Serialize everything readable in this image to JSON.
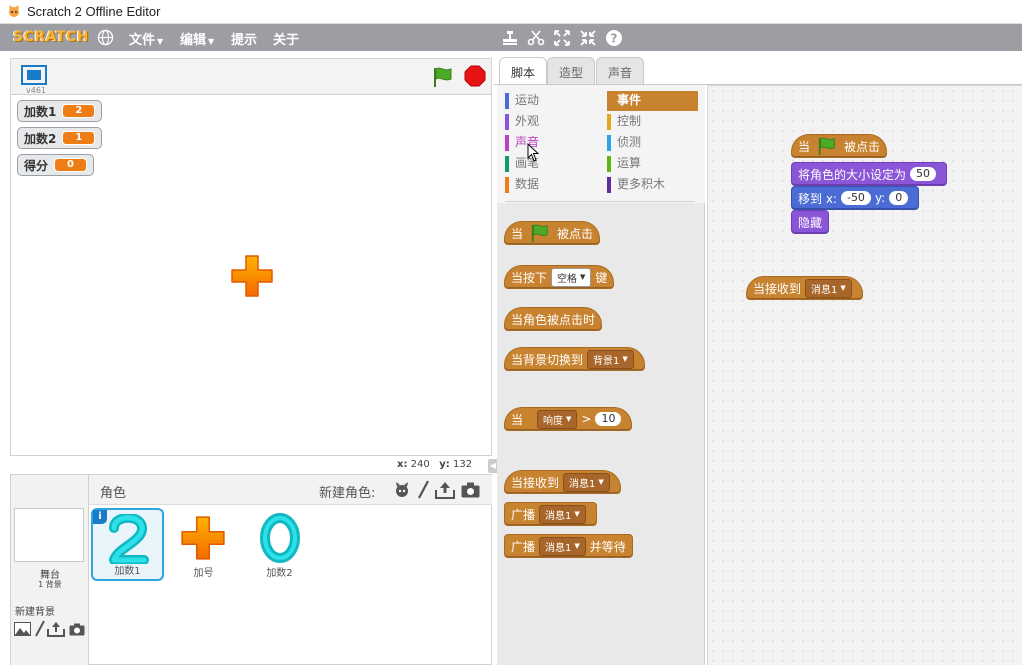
{
  "window": {
    "title": "Scratch 2 Offline Editor"
  },
  "menubar": {
    "logo": "SCRATCH",
    "file": "文件",
    "edit": "编辑",
    "tips": "提示",
    "about": "关于"
  },
  "stage": {
    "version": "v461",
    "monitors": [
      {
        "label": "加数1",
        "value": "2"
      },
      {
        "label": "加数2",
        "value": "1"
      },
      {
        "label": "得分",
        "value": "0"
      }
    ],
    "coords": {
      "x_label": "x:",
      "x": "240",
      "y_label": "y:",
      "y": "132"
    }
  },
  "sprites_panel": {
    "stage_label": "舞台",
    "stage_backdrops": "1 背景",
    "new_backdrop": "新建背景",
    "header": "角色",
    "new_sprite": "新建角色:",
    "sprites": [
      {
        "name": "加数1",
        "selected": true
      },
      {
        "name": "加号",
        "selected": false
      },
      {
        "name": "加数2",
        "selected": false
      }
    ]
  },
  "tabs": {
    "scripts": "脚本",
    "costumes": "造型",
    "sounds": "声音"
  },
  "categories": {
    "left": [
      {
        "label": "运动",
        "color": "#4a6cd4"
      },
      {
        "label": "外观",
        "color": "#8a55d7"
      },
      {
        "label": "声音",
        "color": "#bb42c3"
      },
      {
        "label": "画笔",
        "color": "#0e9a6c"
      },
      {
        "label": "数据",
        "color": "#ee7d16"
      }
    ],
    "right": [
      {
        "label": "事件",
        "color": "#c88330"
      },
      {
        "label": "控制",
        "color": "#e1a91a"
      },
      {
        "label": "侦测",
        "color": "#2ca5e2"
      },
      {
        "label": "运算",
        "color": "#5cb712"
      },
      {
        "label": "更多积木",
        "color": "#632d99"
      }
    ]
  },
  "palette": {
    "when_flag_a": "当",
    "when_flag_b": "被点击",
    "key_a": "当按下",
    "key_dd": "空格",
    "key_b": "键",
    "sprite_clicked": "当角色被点击时",
    "backdrop_a": "当背景切换到",
    "backdrop_dd": "背景1",
    "gt_a": "当",
    "gt_dd": "响度",
    "gt_op": ">",
    "gt_val": "10",
    "recv_a": "当接收到",
    "recv_dd": "消息1",
    "bc_a": "广播",
    "bc_dd": "消息1",
    "bcw_a": "广播",
    "bcw_dd": "消息1",
    "bcw_b": "并等待"
  },
  "script_area": {
    "flag_a": "当",
    "flag_b": "被点击",
    "size_a": "将角色的大小设定为",
    "size_val": "50",
    "goto_a": "移到 x:",
    "goto_x": "-50",
    "goto_b": "y:",
    "goto_y": "0",
    "hide": "隐藏",
    "recv_a": "当接收到",
    "recv_dd": "消息1"
  }
}
